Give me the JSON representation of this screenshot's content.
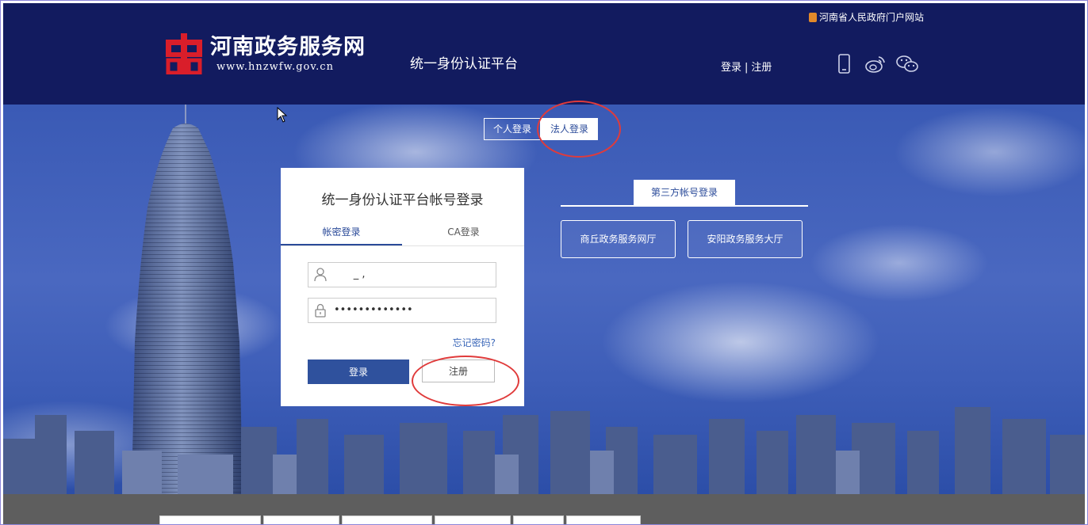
{
  "header": {
    "gov_portal_link": "河南省人民政府门户网站",
    "logo_title": "河南政务服务网",
    "logo_url": "www.hnzwfw.gov.cn",
    "platform_name": "统一身份认证平台",
    "login_link": "登录",
    "separator": "|",
    "register_link": "注册",
    "icons": [
      "mobile-icon",
      "weibo-icon",
      "wechat-icon"
    ]
  },
  "login_type": {
    "personal": "个人登录",
    "legal": "法人登录",
    "selected": "legal"
  },
  "login_card": {
    "title": "统一身份认证平台帐号登录",
    "tabs": [
      {
        "label": "帐密登录",
        "active": true
      },
      {
        "label": "CA登录",
        "active": false
      }
    ],
    "username_value": "      _ ,",
    "password_value": "•••••••••••••",
    "forgot_password": "忘记密码?",
    "login_button": "登录",
    "register_button": "注册"
  },
  "third_party": {
    "label": "第三方帐号登录",
    "options": [
      "商丘政务服务网厅",
      "安阳政务服务大厅"
    ]
  },
  "colors": {
    "header_bg": "#121b5f",
    "accent_blue": "#2f519d",
    "logo_red": "#d91e2a",
    "annotation_red": "#e03b3b"
  }
}
